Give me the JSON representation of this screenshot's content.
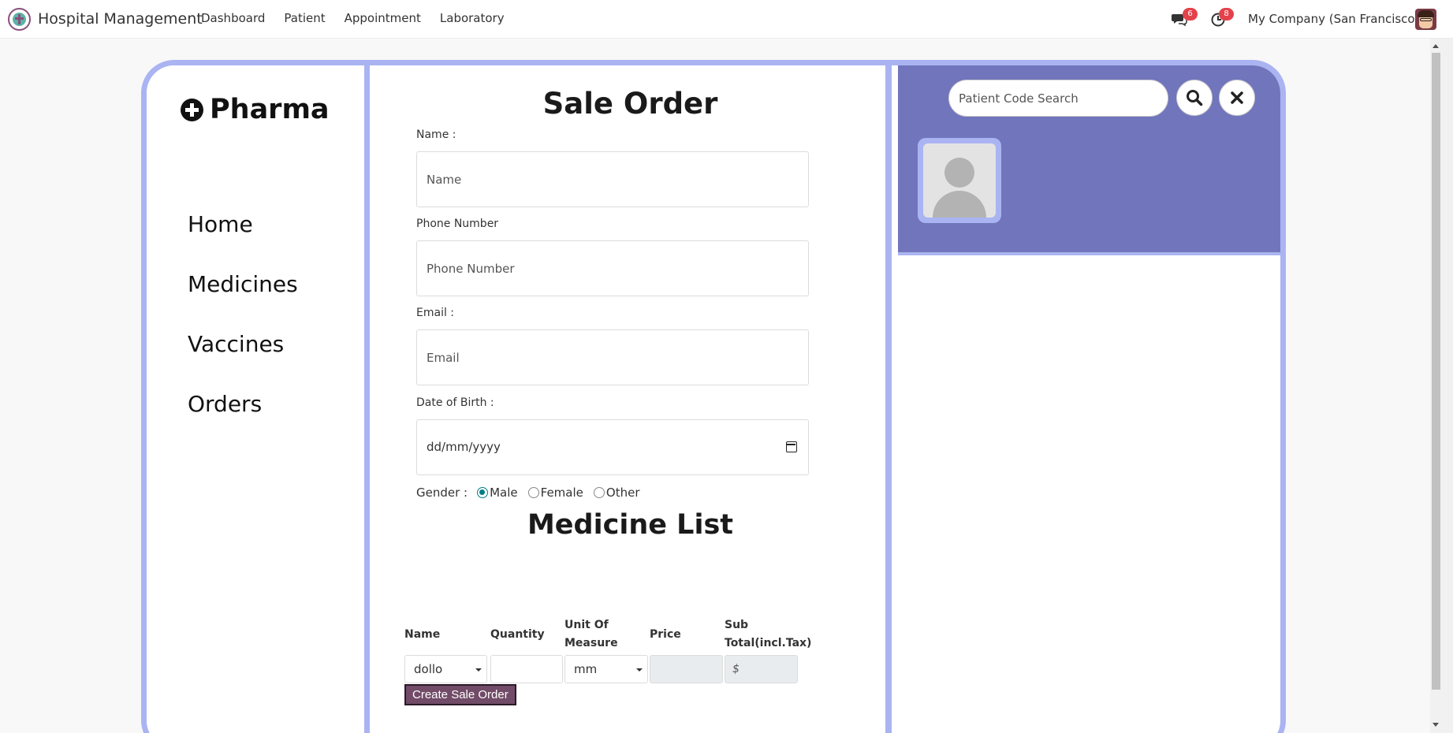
{
  "app": {
    "name": "Hospital Management",
    "menu": [
      "Dashboard",
      "Patient",
      "Appointment",
      "Laboratory"
    ],
    "messages_count": "6",
    "activities_count": "8",
    "company": "My Company (San Francisco)"
  },
  "sidebar": {
    "brand": "Pharma",
    "items": [
      "Home",
      "Medicines",
      "Vaccines",
      "Orders"
    ]
  },
  "form": {
    "title": "Sale Order",
    "name_label": "Name :",
    "name_placeholder": "Name",
    "phone_label": "Phone Number",
    "phone_placeholder": "Phone Number",
    "email_label": "Email :",
    "email_placeholder": "Email",
    "dob_label": "Date of Birth :",
    "dob_placeholder": "dd/mm/yyyy",
    "gender_label": "Gender :",
    "gender_options": [
      "Male",
      "Female",
      "Other"
    ],
    "gender_selected": "Male"
  },
  "medicine_list": {
    "title": "Medicine List",
    "headers": {
      "name": "Name",
      "quantity": "Quantity",
      "uom_line1": "Unit Of",
      "uom_line2": "Measure",
      "price": "Price",
      "subtotal_line1": "Sub",
      "subtotal_line2": "Total(incl.Tax)"
    },
    "row": {
      "name_value": "dollo",
      "uom_value": "mm",
      "subtotal_value": "$"
    },
    "create_button": "Create Sale Order"
  },
  "patient_panel": {
    "search_placeholder": "Patient Code Search"
  },
  "colors": {
    "frame": "#aab4f2",
    "panel": "#7175bc",
    "primary_button": "#714b67",
    "radio_accent": "#017e84",
    "badge": "#e4424b"
  }
}
